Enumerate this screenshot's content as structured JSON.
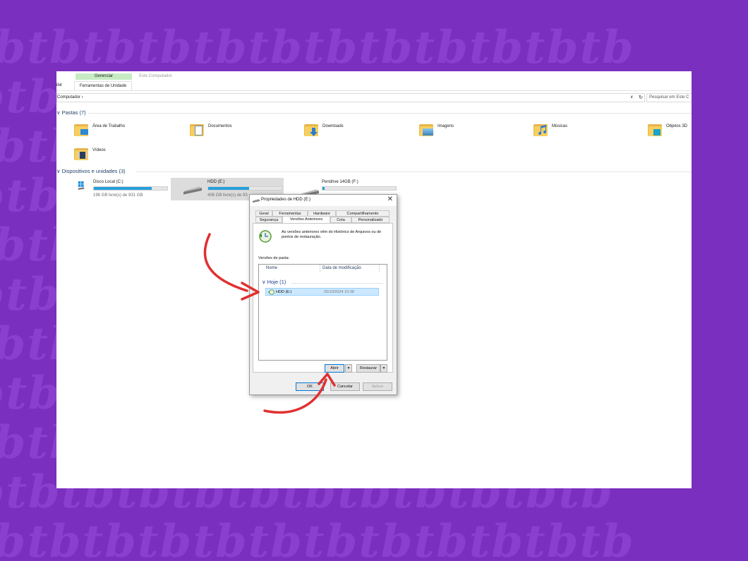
{
  "watermark_text": "tbtbtbtbtbtbtbtbtbtbtbtb",
  "ribbon": {
    "gerenciar_label": "Gerenciar",
    "window_title": "Este Computador",
    "exibir_label": "ibir",
    "ferramentas_tab_label": "Ferramentas de Unidade"
  },
  "address": {
    "path": "Computador  ›",
    "dropdown_icon": "chevron-down-icon",
    "refresh_glyph": "↻",
    "search_placeholder": "Pesquisar em Este C"
  },
  "pastas": {
    "header": "Pastas (7)",
    "items": [
      {
        "label": "Área de Trabalho",
        "icon": "desktop-folder-icon"
      },
      {
        "label": "Documentos",
        "icon": "documents-folder-icon"
      },
      {
        "label": "Downloads",
        "icon": "downloads-folder-icon"
      },
      {
        "label": "Imagens",
        "icon": "pictures-folder-icon"
      },
      {
        "label": "Músicas",
        "icon": "music-folder-icon"
      },
      {
        "label": "Objetos 3D",
        "icon": "objects-3d-folder-icon"
      },
      {
        "label": "Vídeos",
        "icon": "videos-folder-icon"
      }
    ]
  },
  "devices": {
    "header": "Dispositivos e unidades (3)",
    "drives": [
      {
        "name": "Disco Local (C:)",
        "free": "196 GB livre(s) de 931 GB",
        "used_fraction": 0.79
      },
      {
        "name": "HDD (E:)",
        "free": "406 GB livre(s) de 93",
        "used_fraction": 0.56
      },
      {
        "name": "Pendrive 14GB (F:)",
        "free": "",
        "used_fraction": 0.03
      }
    ]
  },
  "dialog": {
    "title": "Propriedades de HDD (E:)",
    "close_glyph": "✕",
    "tabs_row1": [
      "Geral",
      "Ferramentas",
      "Hardware",
      "Compartilhamento"
    ],
    "tabs_row2": [
      "Segurança",
      "Versões Anteriores",
      "Cota",
      "Personalizado"
    ],
    "info_text": "As versões anteriores vêm do Histórico de Arquivos ou de pontos de restauração.",
    "versions_label": "Versões de pasta:",
    "columns": [
      "Nome",
      "Data de modificação"
    ],
    "group_label": "Hoje (1)",
    "group_chevron": "∨",
    "row": {
      "name": "HDD (E:)",
      "date": "25/10/2024 10:38"
    },
    "buttons": {
      "open": "Abrir",
      "restore": "Restaurar",
      "dropdown_glyph": "▾",
      "ok": "OK",
      "cancel": "Cancelar",
      "apply": "Aplicar"
    }
  },
  "colors": {
    "background": "#7b2fbe",
    "annotation_arrow": "#e03030",
    "selection": "#cce8ff",
    "drive_fill": "#26a0da"
  }
}
